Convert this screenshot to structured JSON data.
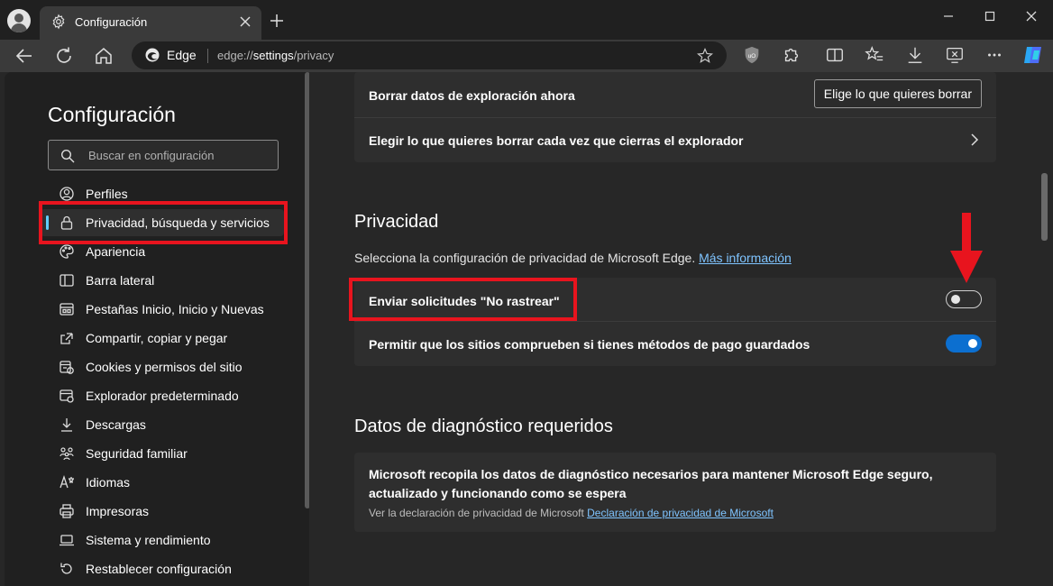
{
  "browser": {
    "tab_title": "Configuración",
    "site_label": "Edge",
    "url_prefix": "edge://",
    "url_host": "settings",
    "url_path": "/privacy"
  },
  "sidebar": {
    "title": "Configuración",
    "search_placeholder": "Buscar en configuración",
    "items": [
      {
        "label": "Perfiles",
        "icon": "profile-icon"
      },
      {
        "label": "Privacidad, búsqueda y servicios",
        "icon": "lock-icon",
        "active": true
      },
      {
        "label": "Apariencia",
        "icon": "palette-icon"
      },
      {
        "label": "Barra lateral",
        "icon": "sidebar-icon"
      },
      {
        "label": "Pestañas Inicio, Inicio y Nuevas",
        "icon": "tabs-icon"
      },
      {
        "label": "Compartir, copiar y pegar",
        "icon": "share-icon"
      },
      {
        "label": "Cookies y permisos del sitio",
        "icon": "cookies-icon"
      },
      {
        "label": "Explorador predeterminado",
        "icon": "browser-icon"
      },
      {
        "label": "Descargas",
        "icon": "download-icon"
      },
      {
        "label": "Seguridad familiar",
        "icon": "family-icon"
      },
      {
        "label": "Idiomas",
        "icon": "language-icon"
      },
      {
        "label": "Impresoras",
        "icon": "printer-icon"
      },
      {
        "label": "Sistema y rendimiento",
        "icon": "laptop-icon"
      },
      {
        "label": "Restablecer configuración",
        "icon": "reset-icon"
      }
    ]
  },
  "clear_data": {
    "now_label": "Borrar datos de exploración ahora",
    "choose_button": "Elige lo que quieres borrar",
    "on_close_label": "Elegir lo que quieres borrar cada vez que cierras el explorador"
  },
  "privacy": {
    "heading": "Privacidad",
    "description": "Selecciona la configuración de privacidad de Microsoft Edge.",
    "more_info_link": "Más información",
    "dnt_label": "Enviar solicitudes \"No rastrear\"",
    "dnt_enabled": false,
    "payment_label": "Permitir que los sitios comprueben si tienes métodos de pago guardados",
    "payment_enabled": true
  },
  "diagnostics": {
    "heading": "Datos de diagnóstico requeridos",
    "text": "Microsoft recopila los datos de diagnóstico necesarios para mantener Microsoft Edge seguro, actualizado y funcionando como se espera",
    "small_text": "Ver la declaración de privacidad de Microsoft",
    "link": "Declaración de privacidad de Microsoft"
  },
  "colors": {
    "accent": "#60cdff",
    "toggle_on": "#0c6fd0",
    "annotation_red": "#e8141e"
  }
}
